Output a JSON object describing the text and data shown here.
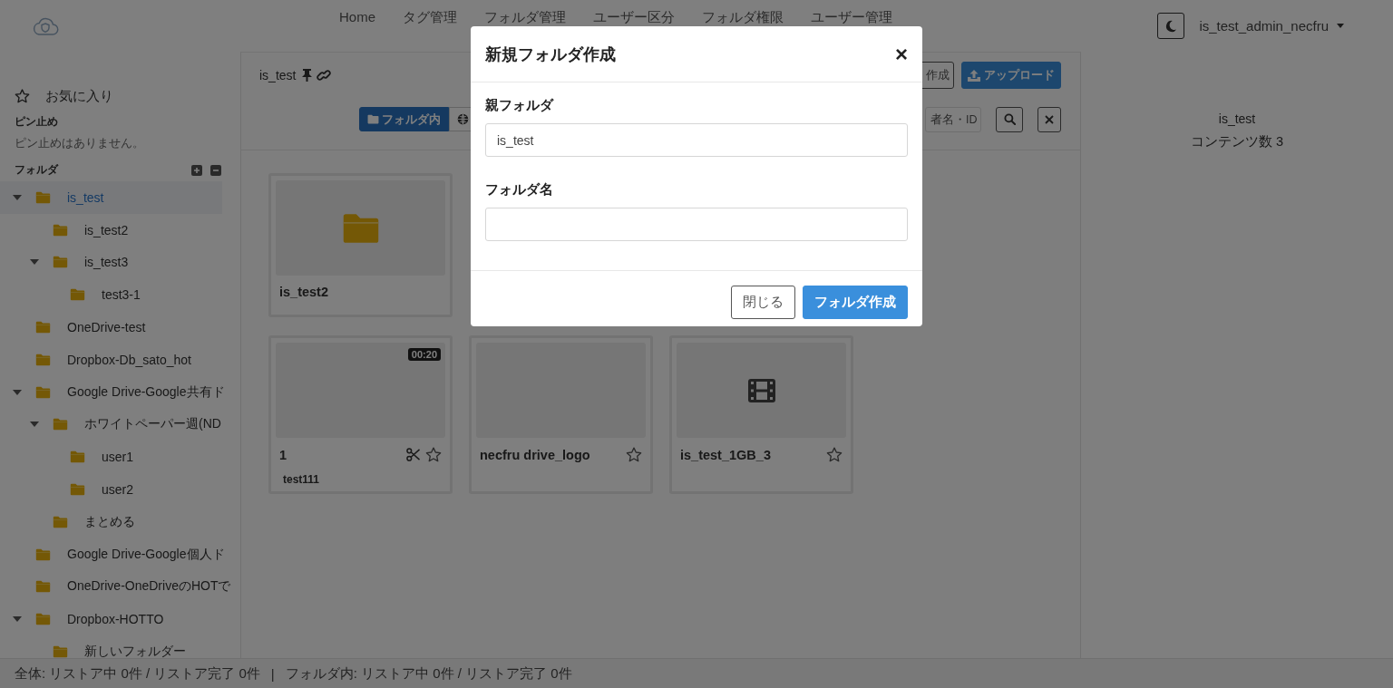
{
  "header": {
    "nav": [
      {
        "label": "Home"
      },
      {
        "label": "タグ管理"
      },
      {
        "label": "フォルダ管理"
      },
      {
        "label": "ユーザー区分"
      },
      {
        "label": "フォルダ権限"
      },
      {
        "label": "ユーザー管理"
      }
    ],
    "user": "is_test_admin_necfru"
  },
  "sidebar": {
    "favorites_label": "お気に入り",
    "pinned_label": "ピン止め",
    "pinned_empty": "ピン止めはありません。",
    "folders_label": "フォルダ",
    "tree": [
      {
        "label": "is_test",
        "selected": true,
        "expanded": true,
        "children": [
          {
            "label": "is_test2",
            "selected": false
          },
          {
            "label": "is_test3",
            "selected": false,
            "expanded": true,
            "children": [
              {
                "label": "test3-1",
                "selected": false
              }
            ]
          }
        ]
      },
      {
        "label": "OneDrive-test",
        "selected": false
      },
      {
        "label": "Dropbox-Db_sato_hot",
        "selected": false
      },
      {
        "label": "Google Drive-Google共有ド",
        "selected": false,
        "expanded": true,
        "children": [
          {
            "label": "ホワイトペーパー週(ND",
            "selected": false,
            "expanded": true,
            "children": [
              {
                "label": "user1",
                "selected": false
              },
              {
                "label": "user2",
                "selected": false
              }
            ]
          },
          {
            "label": "まとめる",
            "selected": false
          }
        ]
      },
      {
        "label": "Google Drive-Google個人ド",
        "selected": false
      },
      {
        "label": "OneDrive-OneDriveのHOTで",
        "selected": false
      },
      {
        "label": "Dropbox-HOTTO",
        "selected": false,
        "expanded": true,
        "children": [
          {
            "label": "新しいフォルダー",
            "selected": false
          }
        ]
      }
    ]
  },
  "main": {
    "breadcrumb": "is_test",
    "create_button": "作成",
    "upload_button": "アップロード",
    "scope_tab": {
      "label": "フォルダ内",
      "selected": true
    },
    "search_placeholder": "者名・ID",
    "card_rows": [
      [
        {
          "kind": "folder",
          "name": "is_test2"
        }
      ],
      [
        {
          "kind": "video",
          "name": "1",
          "duration": "00:20",
          "clip": true,
          "favorite": false,
          "tags": [
            "test111"
          ]
        },
        {
          "kind": "image",
          "name": "necfru drive_logo",
          "favorite": false
        },
        {
          "kind": "video_file",
          "name": "is_test_1GB_3",
          "favorite": false
        }
      ]
    ]
  },
  "details": {
    "folder_name": "is_test",
    "content_count": "コンテンツ数 3"
  },
  "modal": {
    "title": "新規フォルダ作成",
    "close": "×",
    "fields": [
      {
        "label": "親フォルダ",
        "value": "is_test"
      },
      {
        "label": "フォルダ名"
      }
    ],
    "buttons": [
      {
        "kind": "secondary",
        "label": "閉じる"
      },
      {
        "kind": "primary",
        "label": "フォルダ作成"
      }
    ]
  },
  "status_bar": [
    "全体: リストア中 0件 / リストア完了 0件",
    "|",
    "フォルダ内: リストア中 0件 / リストア完了 0件"
  ]
}
